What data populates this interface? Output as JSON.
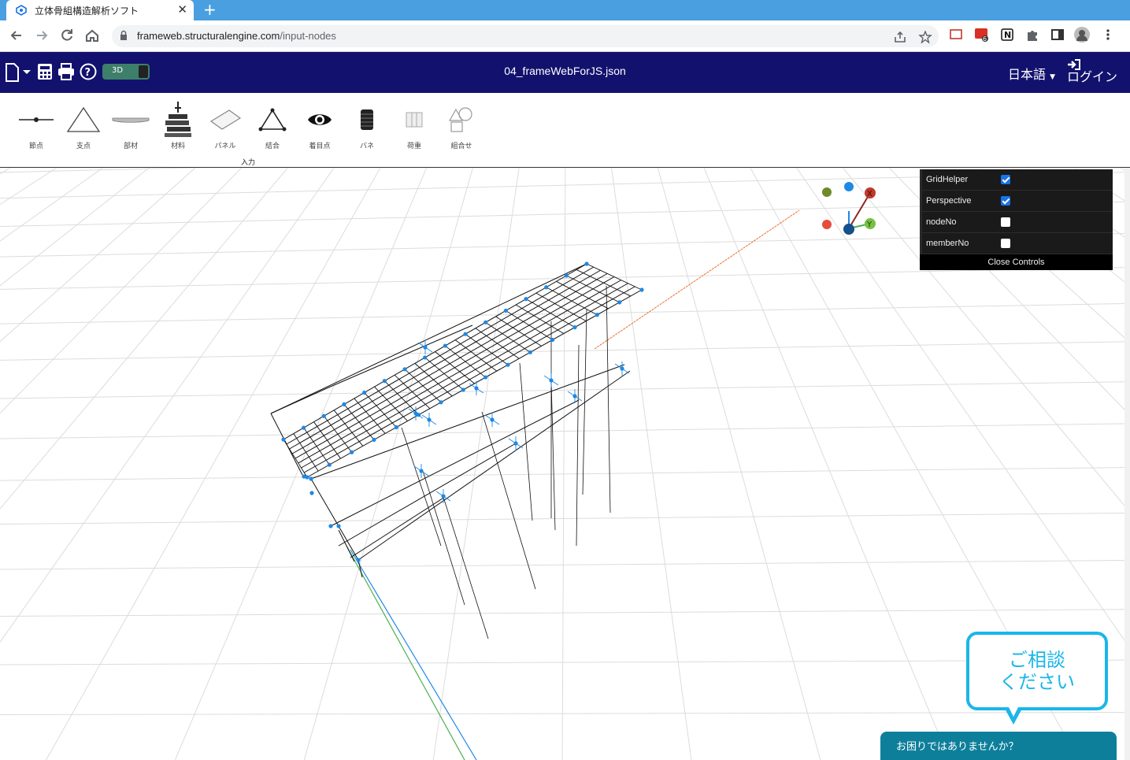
{
  "browser": {
    "tab_title": "立体骨組構造解析ソフト",
    "tab_close": "✕",
    "new_tab": "+",
    "url_domain": "frameweb.structuralengine.com",
    "url_path": "/input-nodes",
    "extension_badge": "6"
  },
  "app": {
    "file_name": "04_frameWebForJS.json",
    "mode_toggle": "3D",
    "language": "日本語",
    "login": "ログイン",
    "tools": [
      {
        "label": "節点",
        "icon": "node-icon"
      },
      {
        "label": "支点",
        "icon": "support-icon"
      },
      {
        "label": "部材",
        "icon": "member-icon"
      },
      {
        "label": "材料",
        "icon": "material-icon"
      },
      {
        "label": "パネル",
        "icon": "panel-icon"
      },
      {
        "label": "結合",
        "icon": "joint-icon"
      },
      {
        "label": "着目点",
        "icon": "eye-icon"
      },
      {
        "label": "バネ",
        "icon": "spring-icon"
      },
      {
        "label": "荷重",
        "icon": "load-icon"
      },
      {
        "label": "組合せ",
        "icon": "combine-icon"
      }
    ],
    "tool_group_label": "入力"
  },
  "gui": {
    "controls": [
      {
        "label": "GridHelper",
        "checked": true
      },
      {
        "label": "Perspective",
        "checked": true
      },
      {
        "label": "nodeNo",
        "checked": false
      },
      {
        "label": "memberNo",
        "checked": false
      }
    ],
    "close_label": "Close Controls"
  },
  "axes_gizmo": {
    "x_label": "X",
    "y_label": "Y",
    "x_color": "#c0392b",
    "y_color": "#4caf50",
    "z_color": "#1565c0"
  },
  "help": {
    "bubble_line1": "ご相談",
    "bubble_line2": "ください",
    "bar_text": "お困りではありませんか？"
  },
  "colors": {
    "header_bg": "#12126e",
    "tabbar_bg": "#4a9fe0",
    "node_color": "#1e88e5",
    "accent_cyan": "#1ab6ea"
  }
}
